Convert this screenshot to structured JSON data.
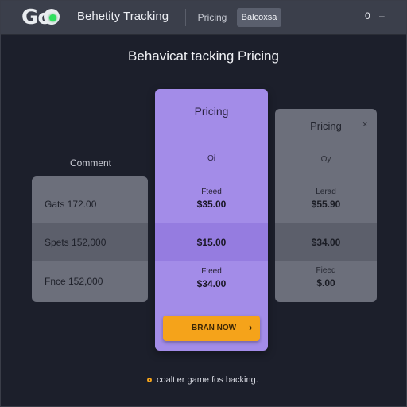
{
  "header": {
    "logo_text": "Go",
    "app_title": "Behetity Tracking",
    "tab_pricing": "Pricing",
    "tab_active": "Balcoxsa",
    "right_glyph_1": "0",
    "right_glyph_2": "–"
  },
  "heading": "Behavicat tacking Pricing",
  "plans": {
    "left": {
      "label": "Comment",
      "rows": [
        "Gats 172.00",
        "Spets 152,000",
        "Fnce 152,000"
      ]
    },
    "middle": {
      "title": "Pricing",
      "subtitle": "Oi",
      "row1_small": "Fteed",
      "row1_price": "$35.00",
      "row2_price": "$15.00",
      "row3_small": "Fteed",
      "row3_price": "$34.00",
      "cta_label": "BRAN NOW",
      "cta_arrow": "›"
    },
    "right": {
      "title": "Pricing",
      "close": "×",
      "subtitle": "Oy",
      "row1_small": "Lerad",
      "row1_price": "$55.90",
      "row2_price": "$34.00",
      "row3_small": "Fieed",
      "row3_price": "$.00"
    }
  },
  "footer": {
    "note": "coaltier game fos backing."
  },
  "colors": {
    "background": "#1c1f2b",
    "header": "#3b3f4b",
    "accent_purple": "#a38ce8",
    "cta_orange": "#f5a31a",
    "card_gray": "#6c6f7b",
    "logo_green": "#2fe05e"
  }
}
